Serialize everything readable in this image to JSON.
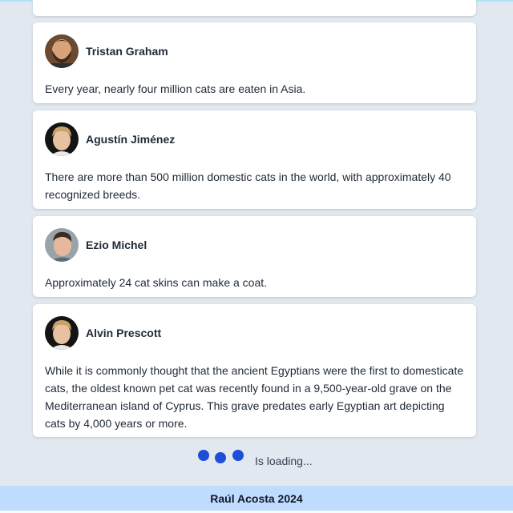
{
  "posts": [
    {
      "author": "Tristan Graham",
      "fact": "Every year, nearly four million cats are eaten in Asia.",
      "avatar": "avatar-man-beard-icon"
    },
    {
      "author": "Agustín Jiménez",
      "fact": "There are more than 500 million domestic cats in the world, with approximately 40 recognized breeds.",
      "avatar": "avatar-man-blond-icon"
    },
    {
      "author": "Ezio Michel",
      "fact": "Approximately 24 cat skins can make a coat.",
      "avatar": "avatar-man-dark-hair-icon"
    },
    {
      "author": "Alvin Prescott",
      "fact": "While it is commonly thought that the ancient Egyptians were the first to domesticate cats, the oldest known pet cat was recently found in a 9,500-year-old grave on the Mediterranean island of Cyprus. This grave predates early Egyptian art depicting cats by 4,000 years or more.",
      "avatar": "avatar-man-blond-icon"
    }
  ],
  "loader": {
    "text": "Is loading..."
  },
  "footer": {
    "text": "Raúl Acosta 2024"
  },
  "colors": {
    "background": "#e2e8f0",
    "card": "#ffffff",
    "accent": "#1d4ed8",
    "footer": "#bfdbfe"
  }
}
